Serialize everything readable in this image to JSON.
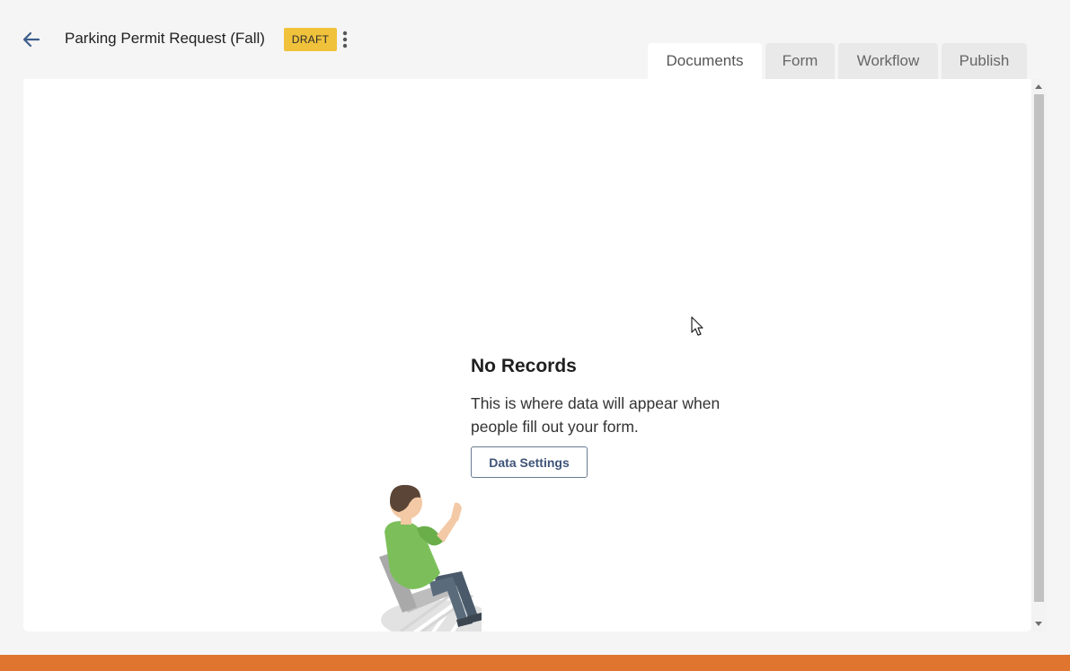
{
  "header": {
    "title": "Parking Permit Request (Fall)",
    "status_badge": "DRAFT",
    "badge_color": "#f0c23c"
  },
  "tabs": [
    {
      "label": "Documents",
      "active": true
    },
    {
      "label": "Form",
      "active": false
    },
    {
      "label": "Workflow",
      "active": false
    },
    {
      "label": "Publish",
      "active": false
    }
  ],
  "empty_state": {
    "title": "No Records",
    "description": "This is where data will appear when people fill out your form.",
    "button_label": "Data Settings"
  },
  "colors": {
    "accent": "#3e5478",
    "footer_bar": "#e07530"
  }
}
